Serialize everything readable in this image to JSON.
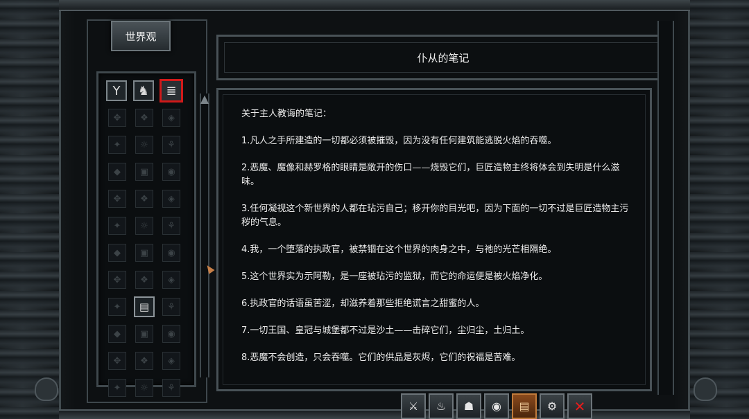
{
  "panel": {
    "tab_title": "世界观"
  },
  "note": {
    "title": "仆从的笔记",
    "heading": "关于主人教诲的笔记：",
    "entries": [
      "1.凡人之手所建造的一切都必须被摧毁，因为没有任何建筑能逃脱火焰的吞噬。",
      "2.恶魔、魔像和赫罗格的眼睛是敞开的伤口——烧毁它们，巨匠造物主终将体会到失明是什么滋味。",
      "3.任何凝视这个新世界的人都在玷污自己；移开你的目光吧，因为下面的一切不过是巨匠造物主污秽的气息。",
      "4.我，一个堕落的执政官，被禁锢在这个世界的肉身之中，与祂的光芒相隔绝。",
      "5.这个世界实为示阿勒，是一座被玷污的监狱，而它的命运便是被火焰净化。",
      "6.执政官的话语虽苦涩，却滋养着那些拒绝谎言之甜蜜的人。",
      "7.一切王国、皇冠与城堡都不过是沙土——击碎它们，尘归尘，土归土。",
      "8.恶魔不会创造，只会吞噬。它们的供品是灰烬，它们的祝福是苦难。"
    ]
  },
  "category_tabs": [
    {
      "icon": "fork-icon",
      "glyph": "Y",
      "active": false
    },
    {
      "icon": "knight-icon",
      "glyph": "♞",
      "active": false
    },
    {
      "icon": "scroll-icon",
      "glyph": "≣",
      "active": true
    }
  ],
  "grid": {
    "rows": 11,
    "cols": 3,
    "selected": {
      "row": 7,
      "col": 1
    }
  },
  "bottom_menu": [
    {
      "icon": "sword-icon",
      "glyph": "⚔"
    },
    {
      "icon": "flame-icon",
      "glyph": "♨"
    },
    {
      "icon": "demon-icon",
      "glyph": "☗"
    },
    {
      "icon": "eye-icon",
      "glyph": "◉"
    },
    {
      "icon": "journal-icon",
      "glyph": "▤",
      "active": true
    },
    {
      "icon": "gear-icon",
      "glyph": "⚙"
    },
    {
      "icon": "close-icon",
      "glyph": "✕"
    }
  ],
  "colors": {
    "active_tab_border": "#d11a1a",
    "active_menu": "#8a4a1c",
    "close": "#e61c1c"
  }
}
